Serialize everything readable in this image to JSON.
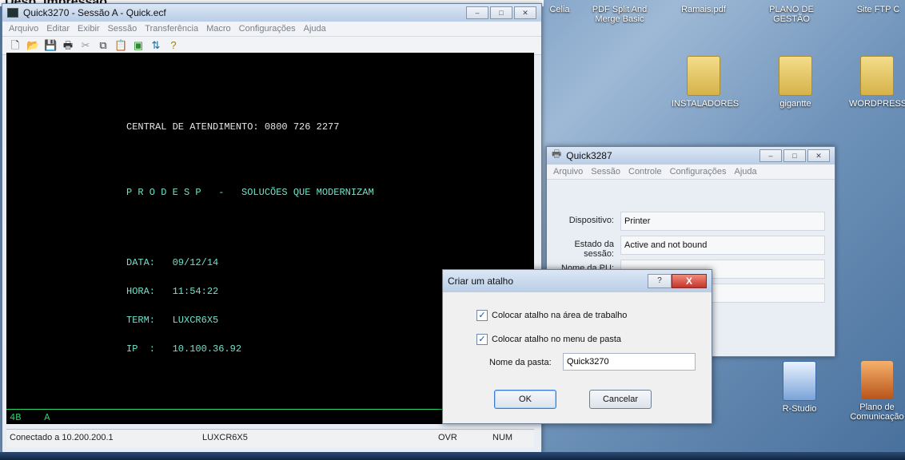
{
  "page_top_title": "Desp. Impressão",
  "desktop": {
    "icons": [
      {
        "label": "Celia",
        "type": "none"
      },
      {
        "label": "PDF Split And Merge Basic",
        "type": "none"
      },
      {
        "label": "Ramais.pdf",
        "type": "none"
      },
      {
        "label": "PLANO DE GESTÃO",
        "type": "none"
      },
      {
        "label": "Site FTP C",
        "type": "none"
      },
      {
        "label": "INSTALADORES",
        "type": "folder"
      },
      {
        "label": "gigantte",
        "type": "folder"
      },
      {
        "label": "WORDPRESS",
        "type": "folder"
      },
      {
        "label": "R-Studio",
        "type": "app"
      },
      {
        "label": "Plano de Comunicação",
        "type": "app2"
      }
    ]
  },
  "main_window": {
    "title": "Quick3270 - Sessão A - Quick.ecf",
    "menu": [
      "Arquivo",
      "Editar",
      "Exibir",
      "Sessão",
      "Transferência",
      "Macro",
      "Configurações",
      "Ajuda"
    ],
    "terminal": {
      "lines": [
        "CENTRAL DE ATENDIMENTO: 0800 726 2277",
        "P R O D E S P   -   SOLUCÕES QUE MODERNIZAM",
        "DATA:   09/12/14",
        "HORA:   11:54:22",
        "TERM:   LUXCR6X5",
        "IP  :   10.100.36.92"
      ],
      "status_line": "4B    A"
    },
    "status": {
      "connection": "Conectado a 10.200.200.1",
      "terminal": "LUXCR6X5",
      "mode": "OVR",
      "num": "NUM"
    }
  },
  "printer_window": {
    "title": "Quick3287",
    "menu": [
      "Arquivo",
      "Sessão",
      "Controle",
      "Configurações",
      "Ajuda"
    ],
    "fields": [
      {
        "label": "Dispositivo:",
        "value": "Printer"
      },
      {
        "label": "Estado da sessão:",
        "value": "Active and not bound"
      },
      {
        "label": "Nome da PU:",
        "value": ""
      },
      {
        "label": "",
        "value": ""
      }
    ]
  },
  "dialog": {
    "title": "Criar um atalho",
    "help_label": "?",
    "close_label": "X",
    "check1": {
      "label": "Colocar atalho na área de trabalho",
      "checked": true
    },
    "check2": {
      "label": "Colocar atalho no menu de pasta",
      "checked": true
    },
    "folder_label": "Nome da pasta:",
    "folder_value": "Quick3270",
    "ok_label": "OK",
    "cancel_label": "Cancelar"
  }
}
